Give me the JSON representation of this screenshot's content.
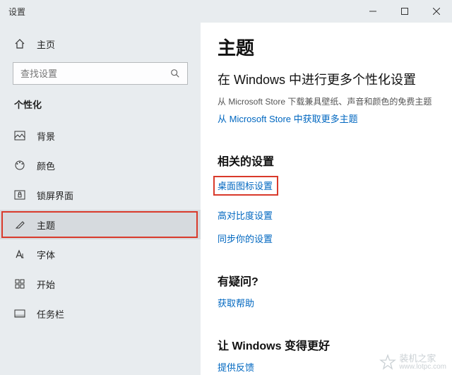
{
  "titlebar": {
    "title": "设置"
  },
  "sidebar": {
    "home": "主页",
    "search_placeholder": "查找设置",
    "section": "个性化",
    "items": [
      {
        "label": "背景"
      },
      {
        "label": "颜色"
      },
      {
        "label": "锁屏界面"
      },
      {
        "label": "主题"
      },
      {
        "label": "字体"
      },
      {
        "label": "开始"
      },
      {
        "label": "任务栏"
      }
    ]
  },
  "main": {
    "heading": "主题",
    "subheading": "在 Windows 中进行更多个性化设置",
    "store_desc": "从 Microsoft Store 下载兼具壁纸、声音和颜色的免费主题",
    "store_link": "从 Microsoft Store 中获取更多主题",
    "related": {
      "title": "相关的设置",
      "links": [
        "桌面图标设置",
        "高对比度设置",
        "同步你的设置"
      ]
    },
    "help": {
      "title": "有疑问?",
      "link": "获取帮助"
    },
    "better": {
      "title": "让 Windows 变得更好",
      "link": "提供反馈"
    }
  },
  "watermark": {
    "brand": "装机之家",
    "url": "www.lotpc.com"
  }
}
